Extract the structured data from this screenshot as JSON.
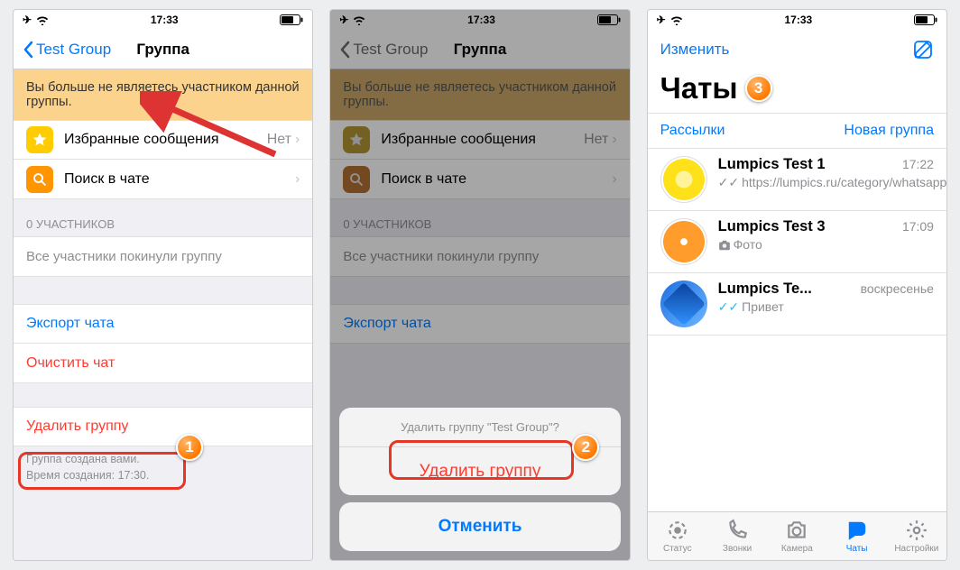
{
  "status": {
    "time": "17:33",
    "airplane": "✈",
    "wifi": "wifi"
  },
  "s1": {
    "back": "Test Group",
    "title": "Группа",
    "banner": "Вы больше не являетесь участником данной группы.",
    "starred": "Избранные сообщения",
    "starred_tail": "Нет",
    "search": "Поиск в чате",
    "members_hdr": "0 УЧАСТНИКОВ",
    "members_empty": "Все участники покинули группу",
    "export": "Экспорт чата",
    "clear": "Очистить чат",
    "delete": "Удалить группу",
    "foot1": "Группа создана вами.",
    "foot2": "Время создания: 17:30."
  },
  "s2": {
    "sheet_title": "Удалить группу \"Test Group\"?",
    "sheet_delete": "Удалить группу",
    "cancel": "Отменить"
  },
  "s3": {
    "edit": "Изменить",
    "title": "Чаты",
    "broadcasts": "Рассылки",
    "new_group": "Новая группа",
    "chats": [
      {
        "name": "Lumpics Test 1",
        "time": "17:22",
        "msg": "https://lumpics.ru/category/whatsapp",
        "tick": "grey"
      },
      {
        "name": "Lumpics Test 3",
        "time": "17:09",
        "msg": "Фото",
        "icon": "camera"
      },
      {
        "name": "Lumpics Te...",
        "time": "воскресенье",
        "msg": "Привет",
        "tick": "blue"
      }
    ],
    "tabs": {
      "status": "Статус",
      "calls": "Звонки",
      "camera": "Камера",
      "chats": "Чаты",
      "settings": "Настройки"
    }
  },
  "steps": {
    "1": "1",
    "2": "2",
    "3": "3"
  }
}
